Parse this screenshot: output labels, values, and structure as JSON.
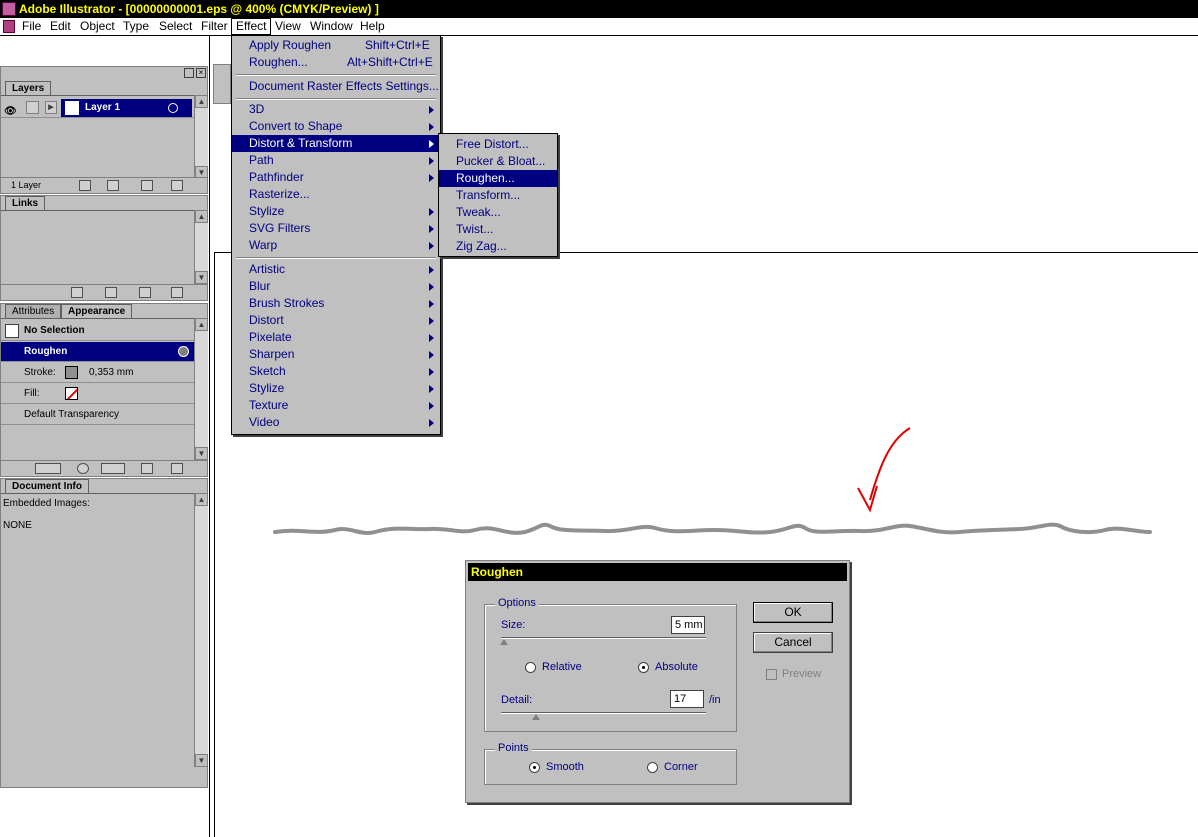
{
  "window": {
    "title": "Adobe Illustrator - [00000000001.eps @ 400% (CMYK/Preview) ]"
  },
  "menubar": [
    "File",
    "Edit",
    "Object",
    "Type",
    "Select",
    "Filter",
    "Effect",
    "View",
    "Window",
    "Help"
  ],
  "effect_menu": {
    "top": [
      {
        "label": "Apply Roughen",
        "shortcut": "Shift+Ctrl+E"
      },
      {
        "label": "Roughen...",
        "shortcut": "Alt+Shift+Ctrl+E"
      }
    ],
    "settings": "Document Raster Effects Settings...",
    "group1": [
      "3D",
      "Convert to Shape",
      "Distort & Transform",
      "Path",
      "Pathfinder",
      "Rasterize...",
      "Stylize",
      "SVG Filters",
      "Warp"
    ],
    "group2": [
      "Artistic",
      "Blur",
      "Brush Strokes",
      "Distort",
      "Pixelate",
      "Sharpen",
      "Sketch",
      "Stylize",
      "Texture",
      "Video"
    ]
  },
  "submenu": [
    "Free Distort...",
    "Pucker & Bloat...",
    "Roughen...",
    "Transform...",
    "Tweak...",
    "Twist...",
    "Zig Zag..."
  ],
  "layers": {
    "tab": "Layers",
    "layer_name": "Layer 1",
    "count": "1 Layer"
  },
  "links": {
    "tab": "Links"
  },
  "appearance": {
    "tabs": [
      "Attributes",
      "Appearance"
    ],
    "selection": "No Selection",
    "effect": "Roughen",
    "stroke_label": "Stroke:",
    "stroke_value": "0,353 mm",
    "fill_label": "Fill:",
    "transparency": "Default Transparency"
  },
  "docinfo": {
    "tab": "Document Info",
    "label": "Embedded Images:",
    "value": "NONE"
  },
  "dialog": {
    "title": "Roughen",
    "options_label": "Options",
    "size_label": "Size:",
    "size_value": "5 mm",
    "relative": "Relative",
    "absolute": "Absolute",
    "detail_label": "Detail:",
    "detail_value": "17",
    "detail_unit": "/in",
    "points_label": "Points",
    "smooth": "Smooth",
    "corner": "Corner",
    "ok": "OK",
    "cancel": "Cancel",
    "preview": "Preview"
  },
  "colors": {
    "titlebar": "#000000",
    "title_text": "#ffff00",
    "highlight": "#000080",
    "panel": "#c0c0c0",
    "arrow": "#e00000",
    "path": "#909090"
  }
}
